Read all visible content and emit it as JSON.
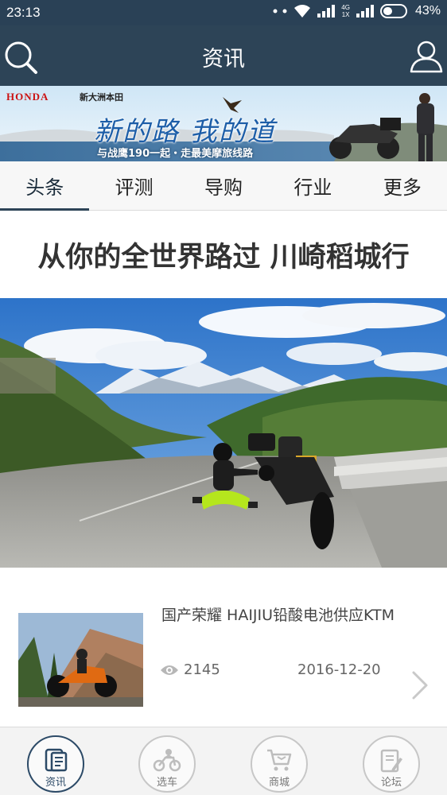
{
  "status_bar": {
    "time": "23:13",
    "network_top": "4G",
    "network_bottom": "1X",
    "battery": "43%",
    "battery_level": 0.43
  },
  "nav": {
    "title": "资讯",
    "left_icon": "search-icon",
    "right_icon": "user-icon"
  },
  "banner": {
    "brand": "HONDA",
    "dealer": "新大洲本田",
    "slogan": "新的路 我的道",
    "subtitle": "与战鹰190一起・走最美摩旅线路"
  },
  "tabs": [
    {
      "label": "头条",
      "active": true
    },
    {
      "label": "评测",
      "active": false
    },
    {
      "label": "导购",
      "active": false
    },
    {
      "label": "行业",
      "active": false
    },
    {
      "label": "更多",
      "active": false
    }
  ],
  "headline": {
    "title": "从你的全世界路过 川崎稻城行"
  },
  "news_list": [
    {
      "title": "国产荣耀 HAIJIU铅酸电池供应KTM",
      "views": "2145",
      "date": "2016-12-20"
    }
  ],
  "bottom_nav": [
    {
      "label": "资讯",
      "icon": "news-icon",
      "active": true
    },
    {
      "label": "选车",
      "icon": "motorcycle-icon",
      "active": false
    },
    {
      "label": "商城",
      "icon": "cart-icon",
      "active": false
    },
    {
      "label": "论坛",
      "icon": "forum-icon",
      "active": false
    }
  ],
  "colors": {
    "nav_bg": "#2d4457",
    "accent": "#2c4a67",
    "tab_bg": "#f7f7f7"
  }
}
